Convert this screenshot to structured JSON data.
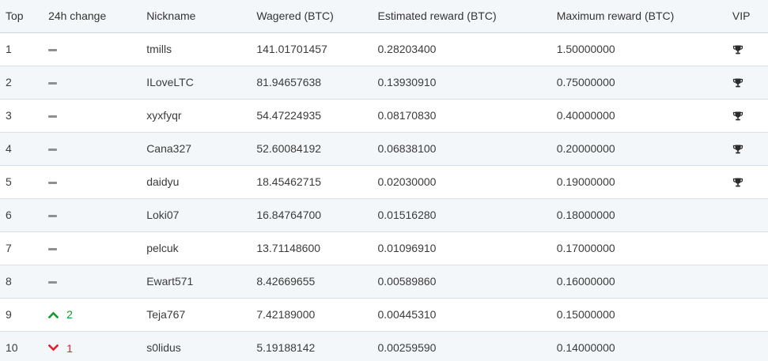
{
  "columns": {
    "top": "Top",
    "change": "24h change",
    "nickname": "Nickname",
    "wagered": "Wagered (BTC)",
    "estimated": "Estimated reward (BTC)",
    "maximum": "Maximum reward (BTC)",
    "vip": "VIP"
  },
  "colors": {
    "up": "#159a2e",
    "down": "#e0202f",
    "neutral": "#8f8f8f",
    "row_alt": "#f4f7fa",
    "border": "#d4e2ee"
  },
  "rows": [
    {
      "top": "1",
      "change_dir": "none",
      "change": "",
      "nickname": "tmills",
      "wagered": "141.01701457",
      "estimated": "0.28203400",
      "maximum": "1.50000000",
      "vip": true
    },
    {
      "top": "2",
      "change_dir": "none",
      "change": "",
      "nickname": "ILoveLTC",
      "wagered": "81.94657638",
      "estimated": "0.13930910",
      "maximum": "0.75000000",
      "vip": true
    },
    {
      "top": "3",
      "change_dir": "none",
      "change": "",
      "nickname": "xyxfyqr",
      "wagered": "54.47224935",
      "estimated": "0.08170830",
      "maximum": "0.40000000",
      "vip": true
    },
    {
      "top": "4",
      "change_dir": "none",
      "change": "",
      "nickname": "Cana327",
      "wagered": "52.60084192",
      "estimated": "0.06838100",
      "maximum": "0.20000000",
      "vip": true
    },
    {
      "top": "5",
      "change_dir": "none",
      "change": "",
      "nickname": "daidyu",
      "wagered": "18.45462715",
      "estimated": "0.02030000",
      "maximum": "0.19000000",
      "vip": true
    },
    {
      "top": "6",
      "change_dir": "none",
      "change": "",
      "nickname": "Loki07",
      "wagered": "16.84764700",
      "estimated": "0.01516280",
      "maximum": "0.18000000",
      "vip": false
    },
    {
      "top": "7",
      "change_dir": "none",
      "change": "",
      "nickname": "pelcuk",
      "wagered": "13.71148600",
      "estimated": "0.01096910",
      "maximum": "0.17000000",
      "vip": false
    },
    {
      "top": "8",
      "change_dir": "none",
      "change": "",
      "nickname": "Ewart571",
      "wagered": "8.42669655",
      "estimated": "0.00589860",
      "maximum": "0.16000000",
      "vip": false
    },
    {
      "top": "9",
      "change_dir": "up",
      "change": "2",
      "nickname": "Teja767",
      "wagered": "7.42189000",
      "estimated": "0.00445310",
      "maximum": "0.15000000",
      "vip": false
    },
    {
      "top": "10",
      "change_dir": "down",
      "change": "1",
      "nickname": "s0lidus",
      "wagered": "5.19188142",
      "estimated": "0.00259590",
      "maximum": "0.14000000",
      "vip": false
    }
  ]
}
